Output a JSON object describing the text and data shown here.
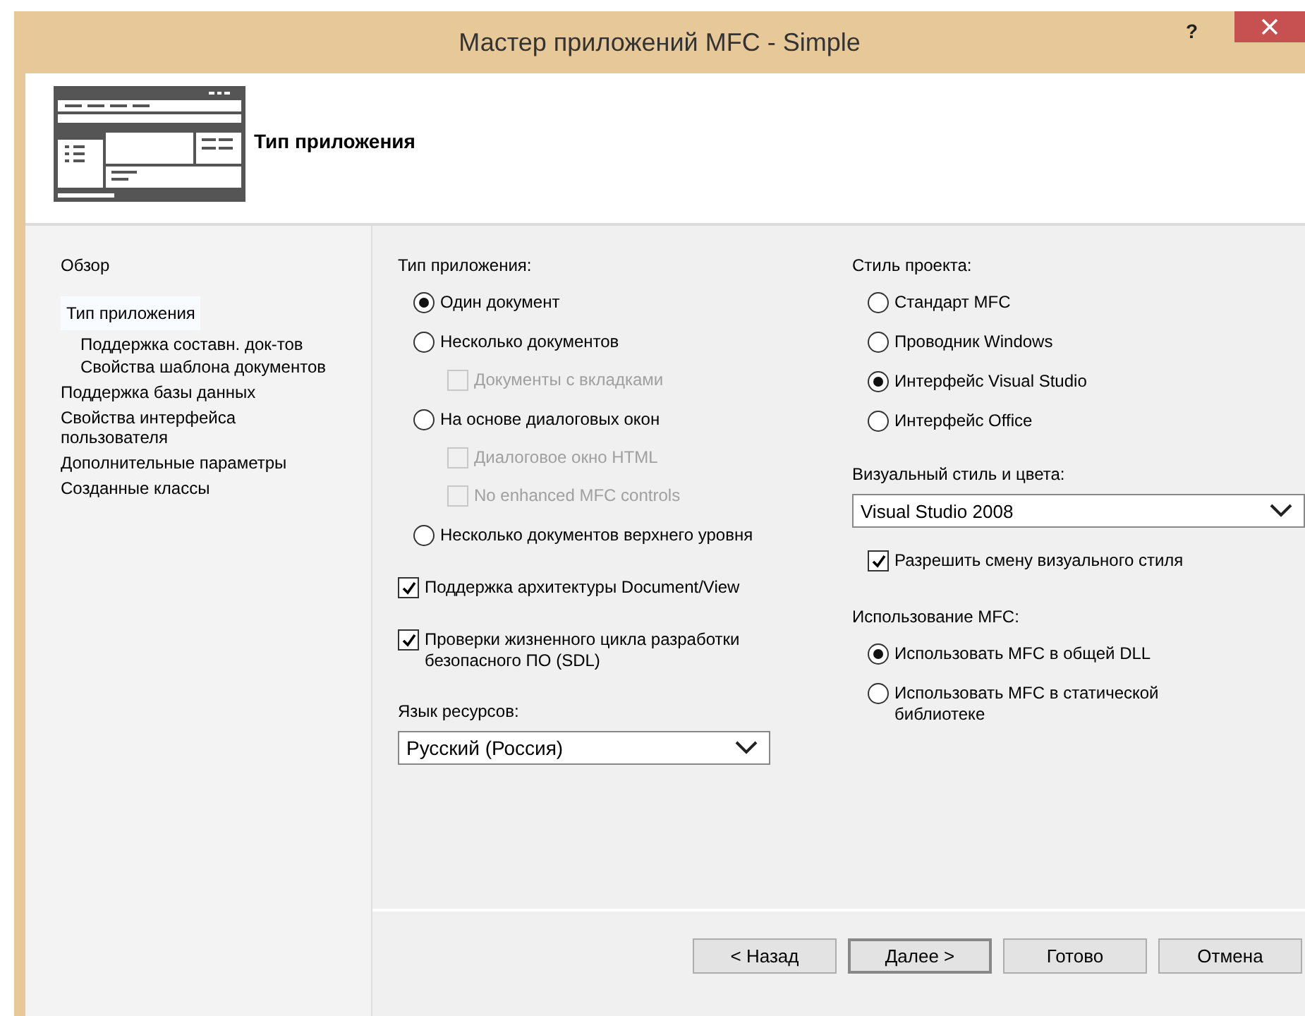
{
  "window": {
    "title": "Мастер приложений MFC - Simple",
    "help_button": "?"
  },
  "header": {
    "title": "Тип приложения"
  },
  "sidebar": {
    "items": [
      {
        "label": "Обзор",
        "selected": false
      },
      {
        "label": "Тип приложения",
        "selected": true,
        "children": [
          {
            "label": "Поддержка составн. док-тов",
            "selected": false
          },
          {
            "label": "Свойства шаблона документов",
            "selected": false
          }
        ]
      },
      {
        "label": "Поддержка базы данных",
        "selected": false
      },
      {
        "label": "Свойства интерфейса пользователя",
        "selected": false
      },
      {
        "label": "Дополнительные параметры",
        "selected": false
      },
      {
        "label": "Созданные классы",
        "selected": false
      }
    ]
  },
  "app_type": {
    "label": "Тип приложения:",
    "options": [
      {
        "label": "Один документ",
        "selected": true
      },
      {
        "label": "Несколько документов",
        "selected": false,
        "children": [
          {
            "label": "Документы с вкладками",
            "checked": false,
            "disabled": true
          }
        ]
      },
      {
        "label": "На основе диалоговых окон",
        "selected": false,
        "children": [
          {
            "label": "Диалоговое окно HTML",
            "checked": false,
            "disabled": true
          },
          {
            "label": "No enhanced MFC controls",
            "checked": false,
            "disabled": true
          }
        ]
      },
      {
        "label": "Несколько документов верхнего уровня",
        "selected": false
      }
    ]
  },
  "options": [
    {
      "label": "Поддержка архитектуры Document/View",
      "checked": true
    },
    {
      "label": "Проверки жизненного цикла разработки безопасного ПО (SDL)",
      "checked": true
    }
  ],
  "resource_language": {
    "label": "Язык ресурсов:",
    "value": "Русский (Россия)"
  },
  "project_style": {
    "label": "Стиль проекта:",
    "options": [
      {
        "label": "Стандарт MFC",
        "selected": false
      },
      {
        "label": "Проводник Windows",
        "selected": false
      },
      {
        "label": "Интерфейс Visual Studio",
        "selected": true
      },
      {
        "label": "Интерфейс Office",
        "selected": false
      }
    ]
  },
  "visual_style": {
    "label": "Визуальный стиль и цвета:",
    "value": "Visual Studio 2008",
    "allow_change": {
      "label": "Разрешить смену визуального стиля",
      "checked": true
    }
  },
  "mfc_usage": {
    "label": "Использование MFC:",
    "options": [
      {
        "label": "Использовать MFC в общей DLL",
        "selected": true
      },
      {
        "label": "Использовать MFC в статической библиотеке",
        "selected": false
      }
    ]
  },
  "buttons": [
    {
      "label": "< Назад",
      "default": false
    },
    {
      "label": "Далее >",
      "default": true
    },
    {
      "label": "Готово",
      "default": false
    },
    {
      "label": "Отмена",
      "default": false
    }
  ]
}
